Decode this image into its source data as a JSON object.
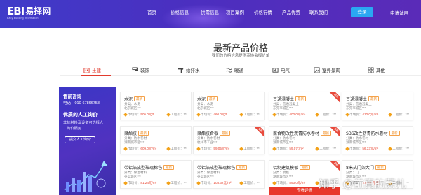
{
  "header": {
    "logo_mark": "EBI",
    "logo_name": "易择网",
    "logo_sub": "Easy Building Information",
    "nav": [
      "首页",
      "价格信息",
      "供需信息",
      "项目案例",
      "价格行情",
      "产品优势",
      "联系我们"
    ],
    "login": "登录",
    "apply": "申请试用"
  },
  "section": {
    "title": "最新产品价格",
    "subtitle": "我们的价格信息提供商协会报价单"
  },
  "tabs": [
    {
      "label": "土建",
      "icon": "building-icon",
      "active": true
    },
    {
      "label": "装饰",
      "icon": "paint-roller-icon"
    },
    {
      "label": "给排水",
      "icon": "pipe-icon"
    },
    {
      "label": "暖通",
      "icon": "hvac-icon"
    },
    {
      "label": "电气",
      "icon": "electric-icon"
    },
    {
      "label": "室外景观",
      "icon": "landscape-icon"
    },
    {
      "label": "其他",
      "icon": "grid-icon"
    }
  ],
  "sidebar": {
    "heading1": "售前咨询",
    "phone": "电话：010-67866758",
    "heading2": "优质的人工询价",
    "desc1": "非标材料及设备可选择人",
    "desc2": "工询价服务",
    "button": "提交人工询价"
  },
  "colors": {
    "header_bg": "#4433c4",
    "accent_red": "#e23b2e",
    "login_blue": "#2aa8f2",
    "badge_orange": "#f08a1c"
  },
  "cards": [
    {
      "title": "水泥",
      "badge": "最新",
      "line1": "分类：水泥",
      "line2": "北京城区***",
      "price_label": "市场价：",
      "price": "505.0元/t",
      "ref": "工程价：***"
    },
    {
      "title": "水泥",
      "badge": "最新",
      "line1": "分类：水泥",
      "line2": "北京城区***",
      "price_label": "市场价：",
      "price": "460.0元/t",
      "ref": "工程价：***"
    },
    {
      "title": "普通混凝土",
      "badge": "最新",
      "line1": "分类：普通混凝土",
      "line2": "东莞市城区***",
      "price_label": "市场价：",
      "price": "400.0元/m³",
      "ref": "工程价：***",
      "ribbon": "最新"
    },
    {
      "title": "普通混凝土",
      "badge": "最新",
      "line1": "分类：普通混凝土",
      "line2": "东莞市城区***",
      "price_label": "市场价：",
      "price": "410.0元/m³",
      "ref": "工程价：***"
    },
    {
      "title": "聚酯胶",
      "badge": "最新",
      "line1": "分类：防水卷材",
      "line2": "湖南城市区***",
      "price_label": "市场价：",
      "price": "609.0元/m²",
      "ref": "工程价：***"
    },
    {
      "title": "聚酯胶合板",
      "badge": "最新",
      "line1": "分类：防水卷材",
      "line2": "杭州市工业***",
      "price_label": "市场价：",
      "price": "59.05元/m²",
      "ref": "工程价：***",
      "ribbon": "最新"
    },
    {
      "title": "聚合物改性沥青防水卷材",
      "badge": "最新",
      "line1": "分类：防水卷材",
      "line2": "湖南城市区***",
      "price_label": "市场价：",
      "price": "59.0元/m²",
      "ref": "工程价：***",
      "ribbon": "最新"
    },
    {
      "title": "SBS改性沥青防水卷材",
      "badge": "最新",
      "line1": "分类：防水卷材",
      "line2": "湖南城市区***",
      "price_label": "市场价：",
      "price": "56.33元/m²",
      "ref": "工程价：***"
    },
    {
      "title": "带铝箔成型玻璃棉毡",
      "badge": "最新",
      "line1": "分类：保温材料",
      "line2": "英实城区***",
      "price_label": "市场价：",
      "price": "81.24元/m²",
      "ref": "工程价：***"
    },
    {
      "title": "带铝箔成型玻璃棉毡",
      "badge": "最新",
      "line1": "分类：保温材料",
      "line2": "英实城区***",
      "price_label": "市场价：",
      "price": "103.32元/m²",
      "ref": "工程价：***"
    },
    {
      "title": "铝制建筑模板",
      "badge": "最新",
      "line1": "分类：模板",
      "line2": "湖南城市区***",
      "price_label": "市场价：",
      "price": "893.0元/m²",
      "ref": "工程价：***",
      "ribbon": "最新"
    },
    {
      "title": "8米式门架大门",
      "badge": "最新",
      "line1": "分类：门",
      "line2": "湖南城市区***",
      "price_label": "市场价：",
      "price": "2778.0元/樘",
      "ref": "工程价：***"
    }
  ],
  "detail_button": "查看详情",
  "watermark": "知乎 @前真的莠儿"
}
